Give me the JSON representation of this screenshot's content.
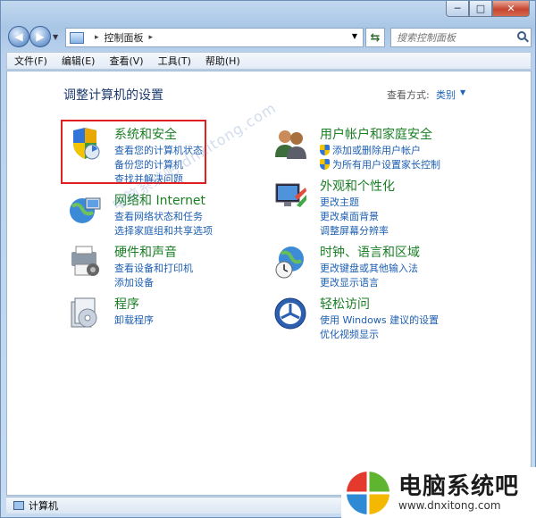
{
  "window": {
    "min": "─",
    "max": "□",
    "close": "✕"
  },
  "address": {
    "path": "控制面板",
    "sep": "▸"
  },
  "search": {
    "placeholder": "搜索控制面板"
  },
  "menu": [
    "文件(F)",
    "编辑(E)",
    "查看(V)",
    "工具(T)",
    "帮助(H)"
  ],
  "header": {
    "title": "调整计算机的设置",
    "view_label": "查看方式:",
    "view_value": "类别"
  },
  "categories_left": [
    {
      "title": "系统和安全",
      "links": [
        "查看您的计算机状态",
        "备份您的计算机",
        "查找并解决问题"
      ]
    },
    {
      "title": "网络和 Internet",
      "links": [
        "查看网络状态和任务",
        "选择家庭组和共享选项"
      ]
    },
    {
      "title": "硬件和声音",
      "links": [
        "查看设备和打印机",
        "添加设备"
      ]
    },
    {
      "title": "程序",
      "links": [
        "卸载程序"
      ]
    }
  ],
  "categories_right": [
    {
      "title": "用户帐户和家庭安全",
      "links": [
        "添加或删除用户帐户",
        "为所有用户设置家长控制"
      ]
    },
    {
      "title": "外观和个性化",
      "links": [
        "更改主题",
        "更改桌面背景",
        "调整屏幕分辨率"
      ]
    },
    {
      "title": "时钟、语言和区域",
      "links": [
        "更改键盘或其他输入法",
        "更改显示语言"
      ]
    },
    {
      "title": "轻松访问",
      "links": [
        "使用 Windows 建议的设置",
        "优化视频显示"
      ]
    }
  ],
  "status": {
    "text": "计算机"
  },
  "brand": {
    "name": "电脑系统吧",
    "url": "www.dnxitong.com"
  },
  "watermark": "电脑系统吧 dnxitong.com"
}
